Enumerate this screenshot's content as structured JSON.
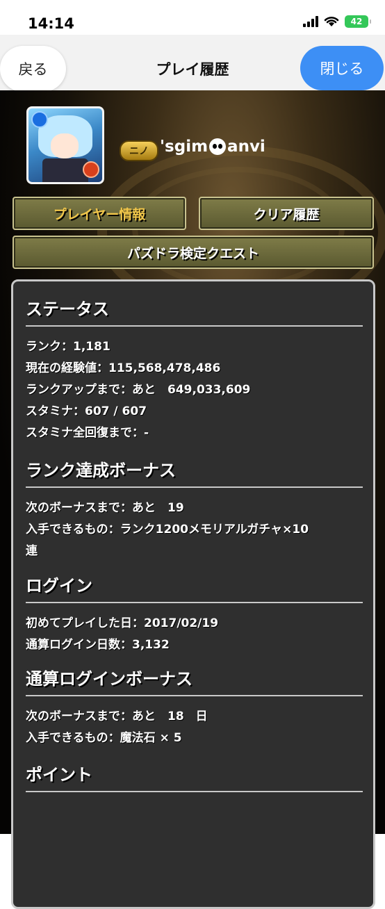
{
  "status_bar": {
    "time": "14:14",
    "battery": "42"
  },
  "nav": {
    "back_label": "戻る",
    "title": "プレイ履歴",
    "close_label": "閉じる"
  },
  "profile": {
    "rank_badge": "ニノ",
    "name_prefix": "'sgim",
    "name_suffix": "anvi"
  },
  "buttons": {
    "player_info": "プレイヤー情報",
    "clear_history": "クリア履歴",
    "kentei_quest": "パズドラ検定クエスト"
  },
  "status": {
    "heading": "ステータス",
    "rank": "ランク：1,181",
    "exp": "現在の経験値：115,568,478,486",
    "rank_up": "ランクアップまで：あと　649,033,609",
    "stamina": "スタミナ：607 / 607",
    "stamina_full": "スタミナ全回復まで：-"
  },
  "rank_bonus": {
    "heading": "ランク達成ボーナス",
    "next": "次のボーナスまで：あと　19",
    "reward_line1": "入手できるもの：ランク1200メモリアルガチャ×10",
    "reward_line2": "連"
  },
  "login": {
    "heading": "ログイン",
    "first_play": "初めてプレイした日：2017/02/19",
    "total_days": "通算ログイン日数：3,132"
  },
  "login_bonus": {
    "heading": "通算ログインボーナス",
    "next": "次のボーナスまで：あと　18　日",
    "reward": "入手できるもの：魔法石 × 5"
  },
  "points": {
    "heading": "ポイント"
  }
}
